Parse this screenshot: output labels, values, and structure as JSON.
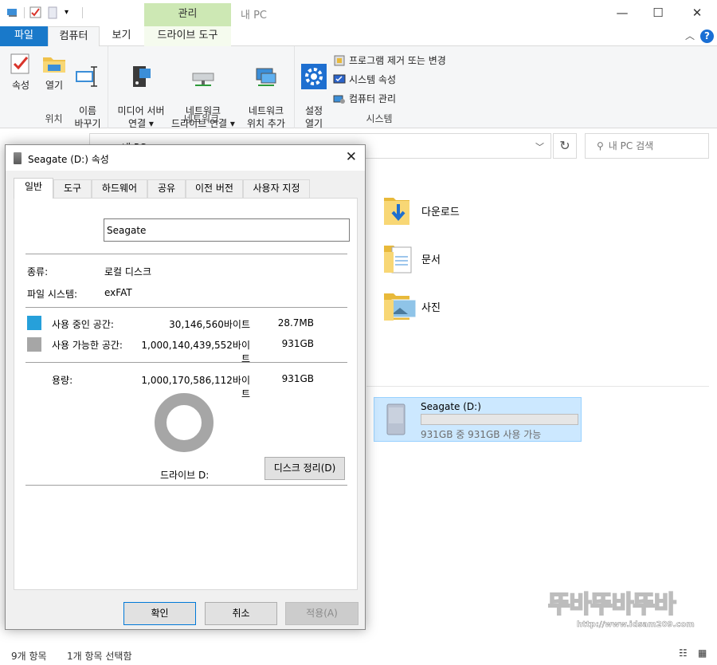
{
  "window": {
    "title": "내 PC",
    "contextual_tab": "관리",
    "controls": {
      "minimize": "—",
      "maximize": "☐",
      "close": "✕"
    }
  },
  "ribbon_tabs": [
    {
      "label": "파일"
    },
    {
      "label": "컴퓨터"
    },
    {
      "label": "보기"
    },
    {
      "label": "드라이브 도구"
    }
  ],
  "ribbon": {
    "location": {
      "label": "위치",
      "buttons": [
        {
          "label": "속성"
        },
        {
          "label": "열기"
        },
        {
          "label": "이름\n바꾸기"
        }
      ]
    },
    "network": {
      "label": "네트워크",
      "buttons": [
        {
          "label": "미디어 서버\n연결 ▾"
        },
        {
          "label": "네트워크\n드라이브 연결 ▾"
        },
        {
          "label": "네트워크\n위치 추가"
        }
      ]
    },
    "system": {
      "label": "시스템",
      "open_settings": "설정\n열기",
      "small": [
        {
          "label": "프로그램 제거 또는 변경"
        },
        {
          "label": "시스템 속성"
        },
        {
          "label": "컴퓨터 관리"
        }
      ]
    }
  },
  "address": {
    "path": "내 PC",
    "search_placeholder": "내 PC 검색"
  },
  "folders": [
    {
      "name": "다운로드"
    },
    {
      "name": "문서"
    },
    {
      "name": "사진"
    }
  ],
  "drive_tile": {
    "name": "Seagate (D:)",
    "free_text": "931GB 중 931GB 사용 가능",
    "used_fraction": 0.0
  },
  "status": {
    "items": "9개 항목",
    "selected": "1개 항목 선택함"
  },
  "watermark": {
    "text": "뚜바뚜바뚜바",
    "url": "http://www.idsam209.com"
  },
  "dialog": {
    "title": "Seagate (D:) 속성",
    "tabs": [
      {
        "label": "일반"
      },
      {
        "label": "도구"
      },
      {
        "label": "하드웨어"
      },
      {
        "label": "공유"
      },
      {
        "label": "이전 버전"
      },
      {
        "label": "사용자 지정"
      }
    ],
    "volume_name": "Seagate",
    "type_label": "종류:",
    "type_value": "로컬 디스크",
    "fs_label": "파일 시스템:",
    "fs_value": "exFAT",
    "used_label": "사용 중인 공간:",
    "used_bytes": "30,146,560바이트",
    "used_size": "28.7MB",
    "free_label": "사용 가능한 공간:",
    "free_bytes": "1,000,140,439,552바이트",
    "free_size": "931GB",
    "capacity_label": "용량:",
    "capacity_bytes": "1,000,170,586,112바이트",
    "capacity_size": "931GB",
    "drive_label": "드라이브 D:",
    "cleanup_button": "디스크 정리(D)",
    "ok_button": "확인",
    "cancel_button": "취소",
    "apply_button": "적용(A)",
    "colors": {
      "used": "#26a0da",
      "free": "#a6a6a6"
    }
  }
}
